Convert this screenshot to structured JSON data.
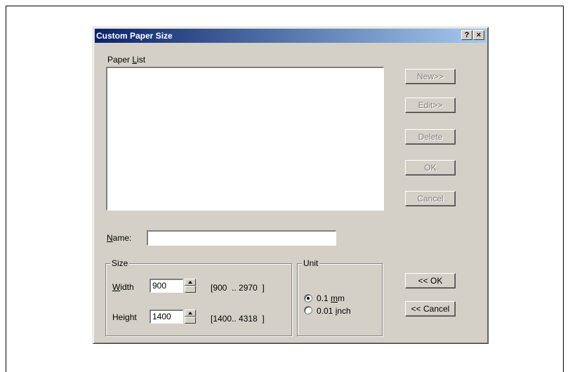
{
  "window": {
    "title": "Custom Paper Size",
    "help_glyph": "?",
    "close_glyph": "×"
  },
  "paper_list": {
    "label_pre": "Paper ",
    "label_accel": "L",
    "label_post": "ist",
    "items": []
  },
  "side_buttons": {
    "new": "New>>",
    "edit": "Edit>>",
    "delete": "Delete",
    "ok": "OK",
    "cancel": "Cancel"
  },
  "name_field": {
    "label_accel": "N",
    "label_post": "ame:",
    "value": ""
  },
  "size_group": {
    "title": "Size",
    "width": {
      "label_accel": "W",
      "label_post": "idth",
      "value": "900",
      "range": "[900  .. 2970  ]"
    },
    "height": {
      "label_pre": "Hei",
      "label_accel": "g",
      "label_post": "ht",
      "value": "1400",
      "range": "[1400.. 4318  ]"
    }
  },
  "unit_group": {
    "title": "Unit",
    "options": [
      {
        "pre": "0.1 ",
        "accel": "m",
        "post": "m",
        "checked": true
      },
      {
        "pre": "0.01 ",
        "accel": "i",
        "post": "nch",
        "checked": false
      }
    ]
  },
  "bottom_buttons": {
    "ok": "<< OK",
    "cancel": "<< Cancel"
  }
}
